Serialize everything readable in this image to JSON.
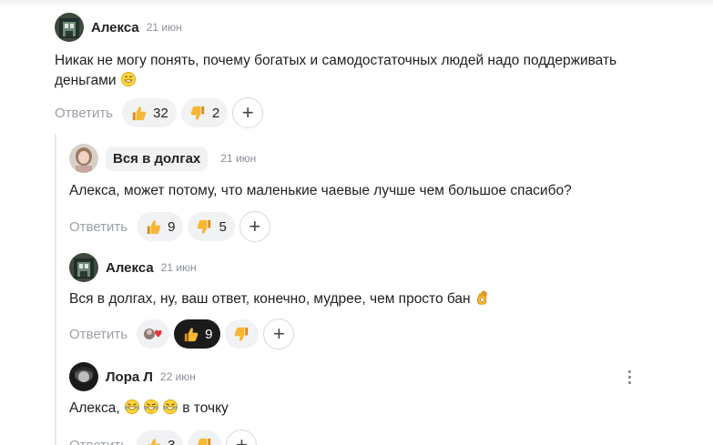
{
  "comments": [
    {
      "author": "Алекса",
      "date": "21 июн",
      "text": "Никак не могу понять, почему богатых и самодостаточных людей надо поддерживать деньгами",
      "reply_label": "Ответить",
      "likes": "32",
      "dislikes": "2"
    },
    {
      "author": "Вся в долгах",
      "date": "21 июн",
      "text": "Алекса, может потому, что маленькие чаевые лучше чем большое спасибо?",
      "reply_label": "Ответить",
      "likes": "9",
      "dislikes": "5"
    },
    {
      "author": "Алекса",
      "date": "21 июн",
      "text": "Вся в долгах, ну, ваш ответ, конечно, мудрее, чем просто бан",
      "reply_label": "Ответить",
      "likes": "9"
    },
    {
      "author": "Лора Л",
      "date": "22 июн",
      "text_prefix": "Алекса,",
      "text_suffix": "в точку",
      "reply_label": "Ответить",
      "likes": "3"
    }
  ],
  "icons": {
    "like": "thumbs-up-icon",
    "dislike": "thumbs-down-icon",
    "add": "add-reaction-icon",
    "more": "more-options-icon"
  },
  "colors": {
    "reaction_bg": "#f1f2f4",
    "reaction_active_bg": "#1b1b1b",
    "muted_text": "#9aa0a8",
    "thumb": "#f5a623"
  }
}
